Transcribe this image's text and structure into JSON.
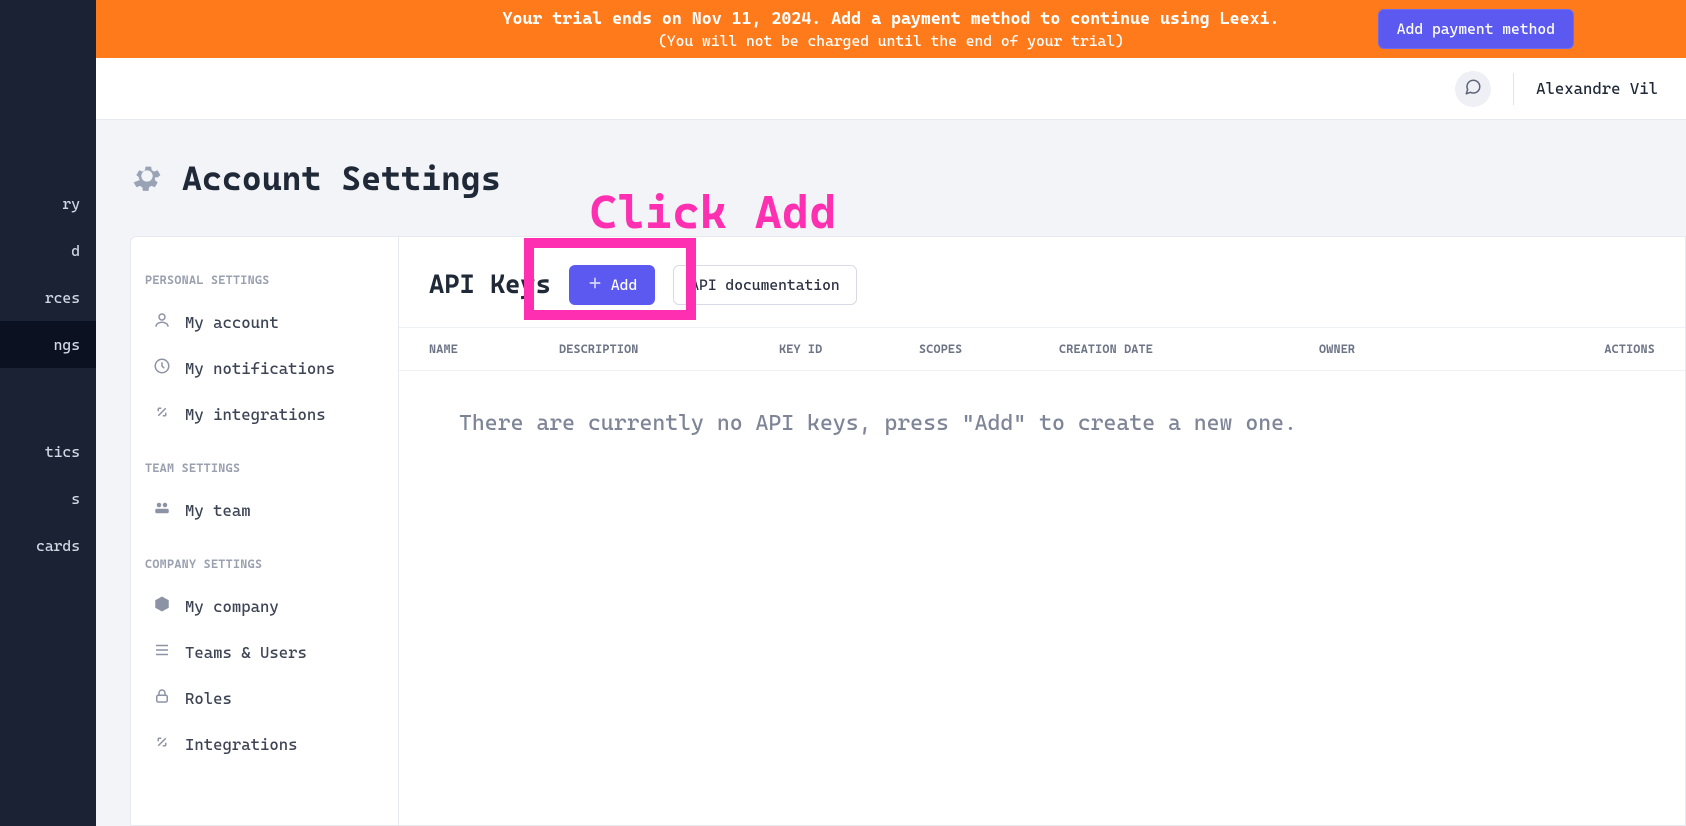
{
  "banner": {
    "line1": "Your trial ends on Nov 11, 2024. Add a payment method to continue using Leexi.",
    "line2": "(You will not be charged until the end of your trial)",
    "cta": "Add payment method"
  },
  "topbar": {
    "username": "Alexandre Vil"
  },
  "annotation": {
    "text": "Click Add"
  },
  "leftnav": {
    "items": [
      {
        "label": "ry",
        "active": false
      },
      {
        "label": "d",
        "active": false
      },
      {
        "label": "rces",
        "active": false
      },
      {
        "label": "ngs",
        "active": true
      }
    ],
    "items2": [
      {
        "label": "tics"
      },
      {
        "label": "s"
      },
      {
        "label": "cards"
      }
    ]
  },
  "page": {
    "title": "Account Settings"
  },
  "settings_nav": {
    "groups": [
      {
        "title": "PERSONAL SETTINGS",
        "items": [
          {
            "icon": "user-icon",
            "label": "My account"
          },
          {
            "icon": "bell-icon",
            "label": "My notifications"
          },
          {
            "icon": "arrows-icon",
            "label": "My integrations"
          }
        ]
      },
      {
        "title": "TEAM SETTINGS",
        "items": [
          {
            "icon": "team-icon",
            "label": "My team"
          }
        ]
      },
      {
        "title": "COMPANY SETTINGS",
        "items": [
          {
            "icon": "cube-icon",
            "label": "My company"
          },
          {
            "icon": "list-icon",
            "label": "Teams & Users"
          },
          {
            "icon": "lock-icon",
            "label": "Roles"
          },
          {
            "icon": "arrows-icon",
            "label": "Integrations"
          }
        ]
      }
    ]
  },
  "main": {
    "title": "API Keys",
    "add_label": "Add",
    "doc_label": "API documentation",
    "columns": {
      "name": "NAME",
      "description": "DESCRIPTION",
      "key_id": "KEY ID",
      "scopes": "SCOPES",
      "creation_date": "CREATION DATE",
      "owner": "OWNER",
      "actions": "ACTIONS"
    },
    "empty": "There are currently no API keys, press \"Add\" to create a new one."
  }
}
